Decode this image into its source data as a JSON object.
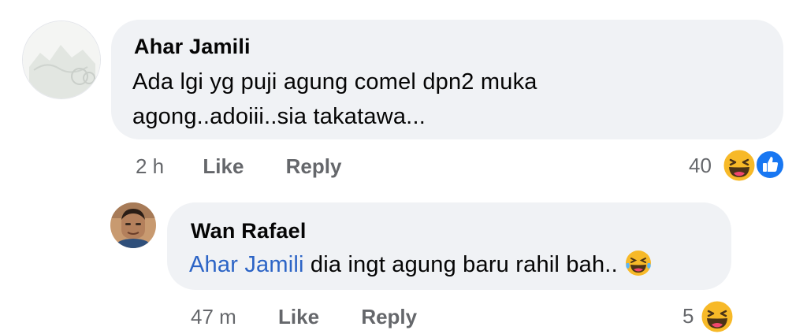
{
  "comments": [
    {
      "author": "Ahar Jamili",
      "text_line1": "Ada lgi yg puji agung comel dpn2 muka",
      "text_line2": "agong..adoiii..sia takatawa...",
      "time": "2 h",
      "like_label": "Like",
      "reply_label": "Reply",
      "reaction_count": "40",
      "reactions": [
        "haha-icon",
        "like-icon"
      ]
    },
    {
      "author": "Wan Rafael",
      "mention": "Ahar Jamili",
      "text": " dia ingt agung baru rahil bah..",
      "inline_emoji": "laughing-tears-emoji",
      "time": "47 m",
      "like_label": "Like",
      "reply_label": "Reply",
      "reaction_count": "5",
      "reactions": [
        "haha-icon"
      ]
    }
  ],
  "colors": {
    "bubble": "#f0f2f5",
    "meta": "#65676b",
    "mention": "#2c64c6",
    "like_blue": "#1877f2",
    "haha_yellow": "#f7b928"
  }
}
